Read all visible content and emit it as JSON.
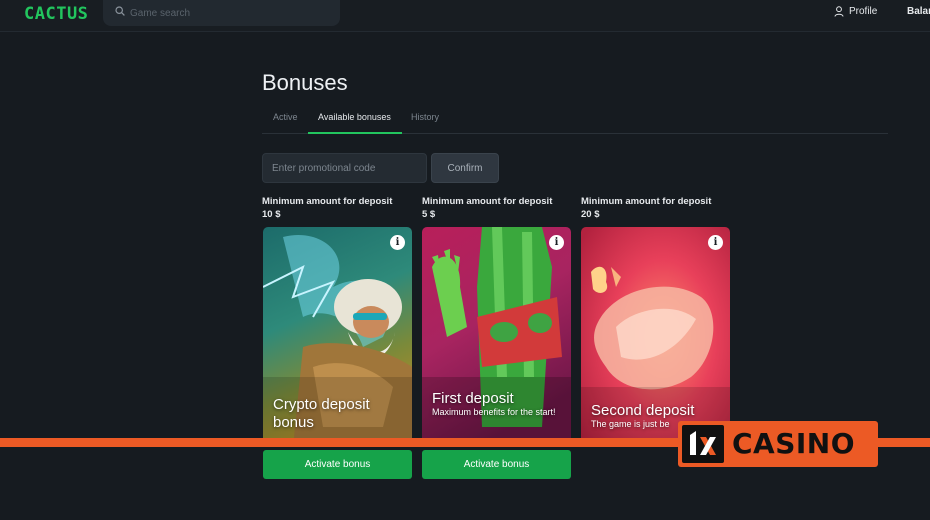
{
  "header": {
    "logo": "CACTUS",
    "search_placeholder": "Game search",
    "profile_label": "Profile",
    "balance_label": "Balan"
  },
  "page": {
    "title": "Bonuses",
    "tabs": [
      {
        "label": "Active",
        "active": false
      },
      {
        "label": "Available bonuses",
        "active": true
      },
      {
        "label": "History",
        "active": false
      }
    ]
  },
  "promo": {
    "placeholder": "Enter promotional code",
    "confirm_label": "Confirm"
  },
  "bonuses": [
    {
      "min_label": "Minimum amount for deposit",
      "min_value": "10 $",
      "title": "Crypto deposit bonus",
      "subtitle": "",
      "info_icon": "info-icon",
      "activate_label": "Activate bonus"
    },
    {
      "min_label": "Minimum amount for deposit",
      "min_value": "5 $",
      "title": "First deposit",
      "subtitle": "Maximum benefits for the start!",
      "info_icon": "info-icon",
      "activate_label": "Activate bonus"
    },
    {
      "min_label": "Minimum amount for deposit",
      "min_value": "20 $",
      "title": "Second deposit",
      "subtitle": "The game is just be",
      "info_icon": "info-icon"
    }
  ],
  "watermark": {
    "text": "CASINO",
    "mark": "1x"
  },
  "colors": {
    "background": "#161b20",
    "accent": "#22c55e",
    "button_green": "#16a34a",
    "watermark_orange": "#ec5a25"
  }
}
